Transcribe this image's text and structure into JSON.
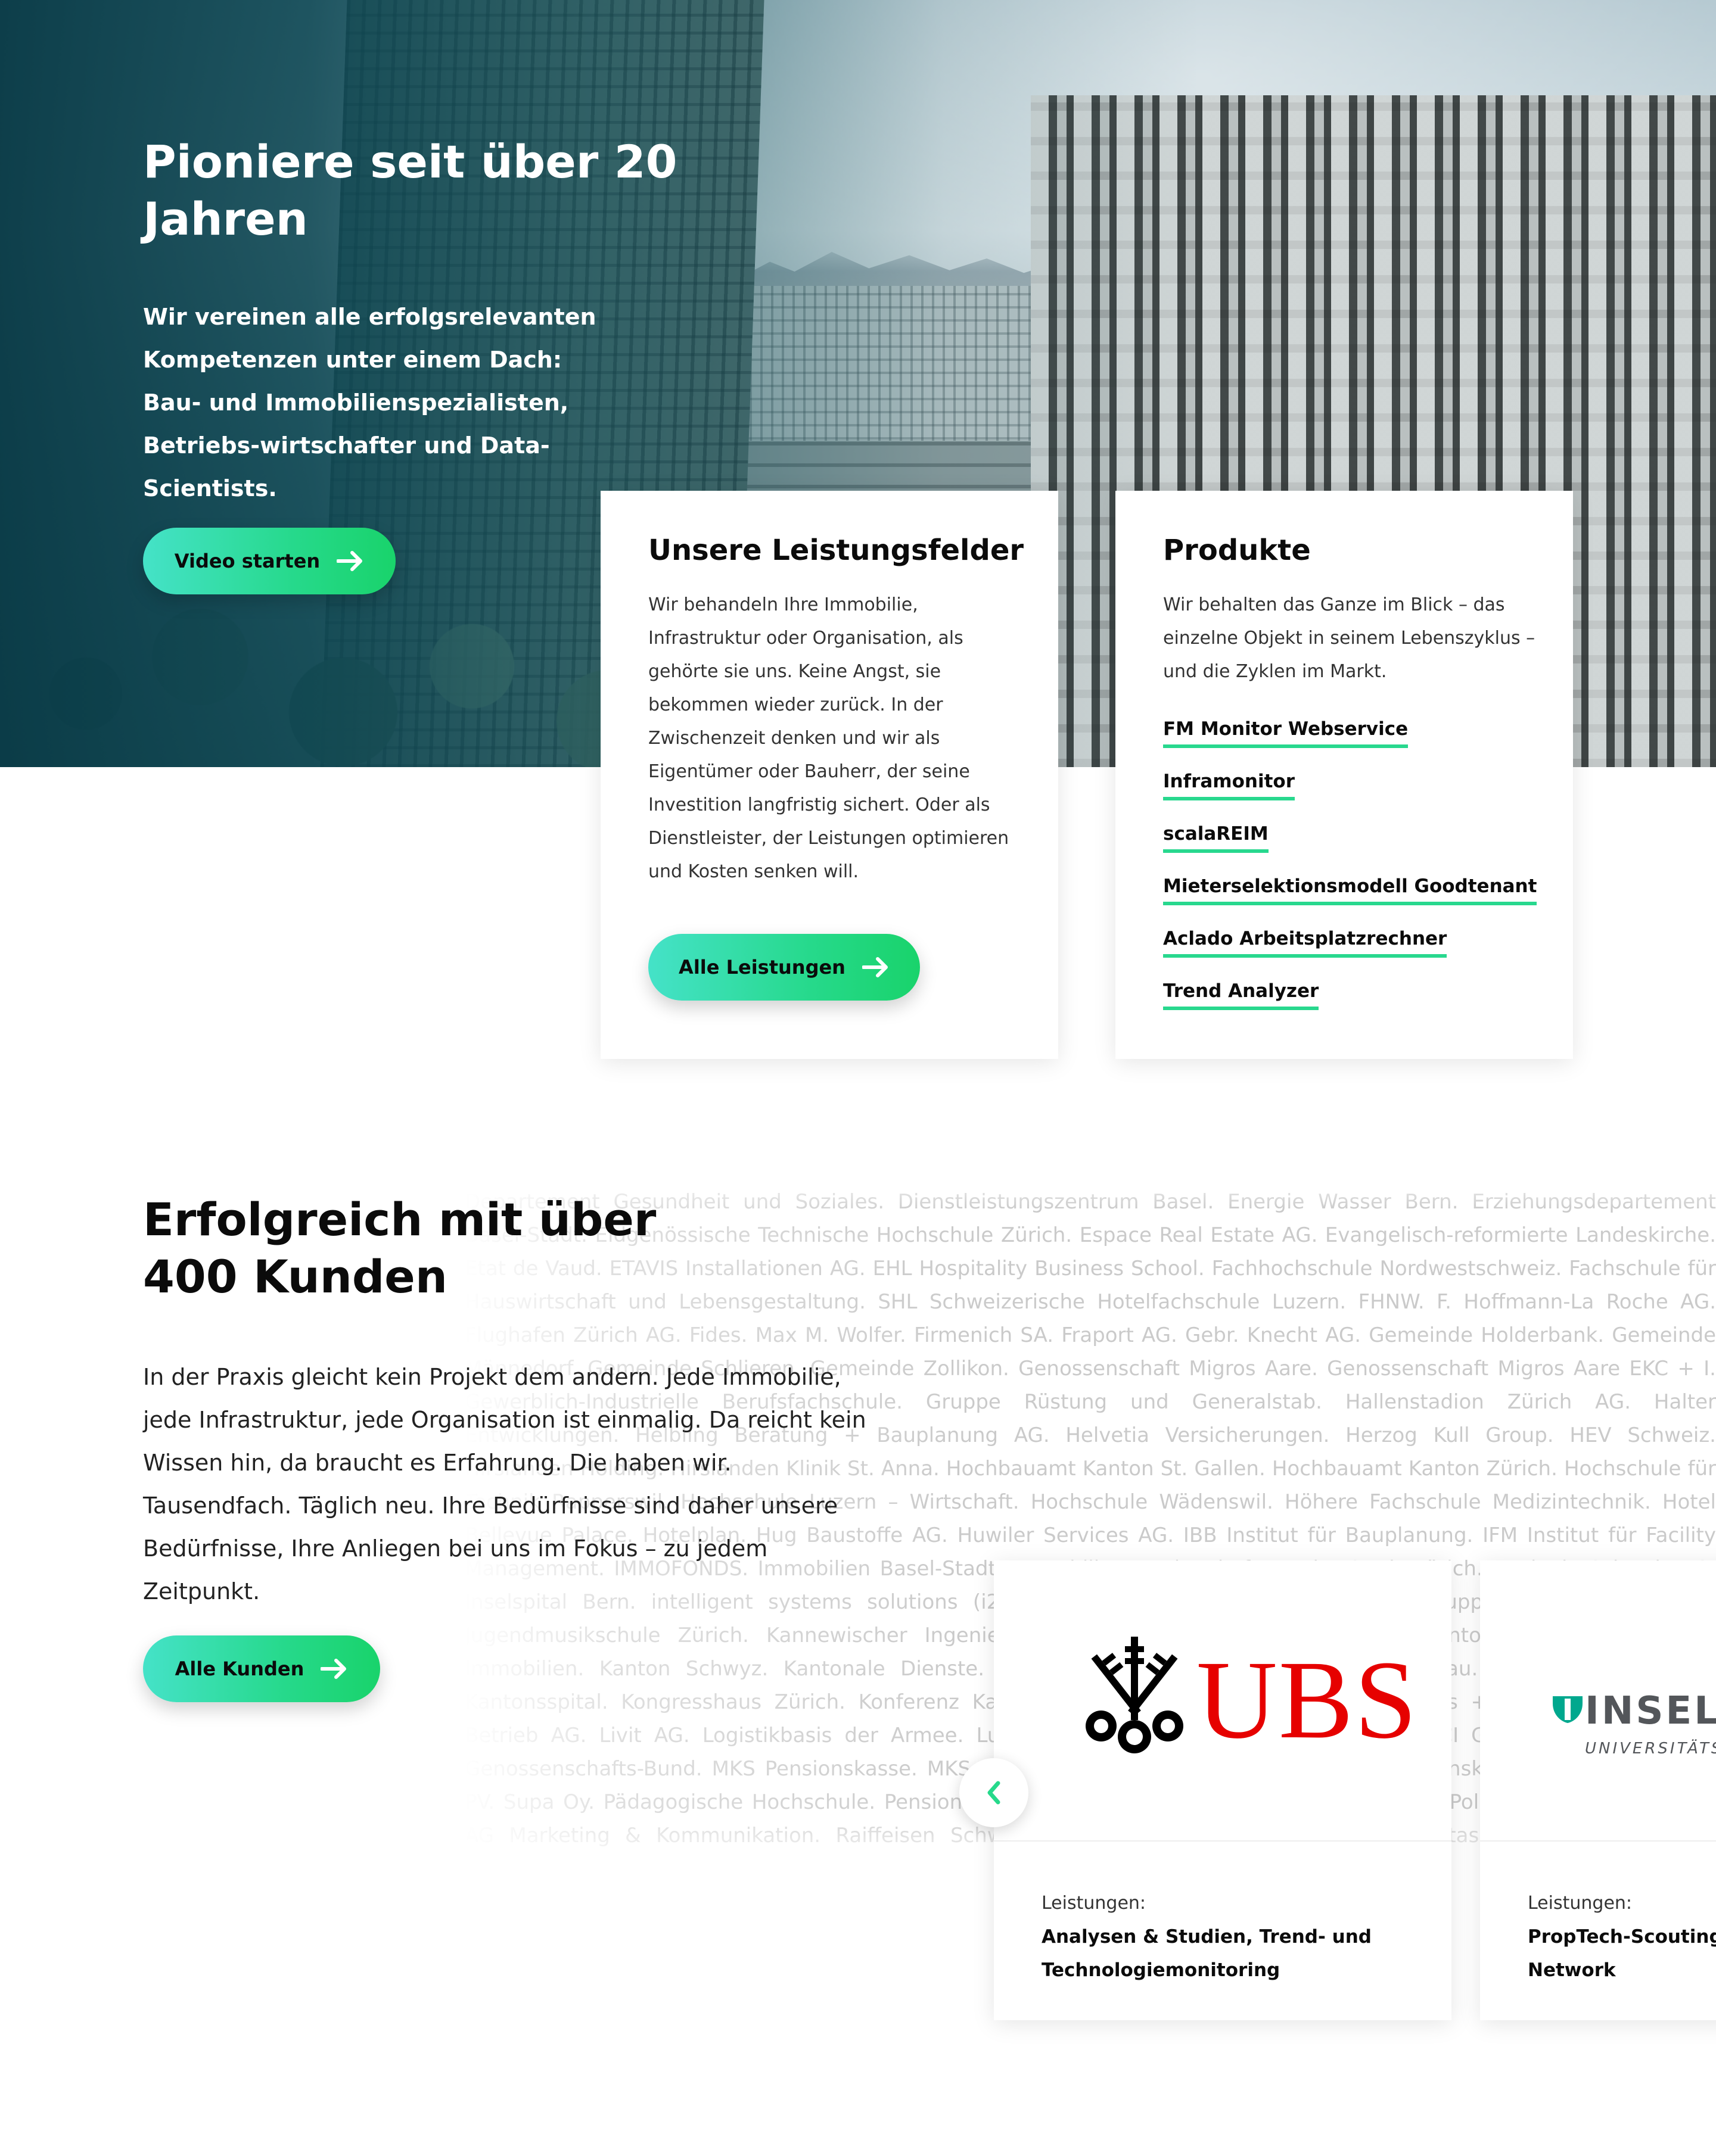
{
  "hero": {
    "title": "Pioniere seit über 20 Jahren",
    "text": "Wir vereinen alle erfolgsrelevanten Kompetenzen unter einem Dach: Bau- und Immobilienspezialisten, Betriebs-wirtschafter und Data-Scientists.",
    "video_button": "Video starten"
  },
  "services_card": {
    "title": "Unsere Leistungsfelder",
    "text": "Wir behandeln Ihre Immobilie, Infrastruktur oder Organisation, als gehörte sie uns. Keine Angst, sie bekommen wieder zurück. In der Zwischenzeit denken und   wir als Eigentümer oder Bauherr, der seine Investition langfristig sichert. Oder als Dienstleister, der Leistungen optimieren und Kosten senken will.",
    "button": "Alle Leistungen"
  },
  "products_card": {
    "title": "Produkte",
    "text": "Wir behalten das Ganze im Blick – das einzelne Objekt in seinem Lebenszyklus – und die Zyklen im Markt.",
    "links": [
      "FM Monitor Webservice",
      "Inframonitor",
      "scalaREIM",
      "Mieterselektionsmodell Goodtenant",
      "Aclado Arbeitsplatzrechner",
      "Trend Analyzer"
    ]
  },
  "customers": {
    "title": "Erfolgreich mit über 400 Kunden",
    "text": "In der Praxis gleicht kein Projekt dem andern. Jede Immobilie, jede Infrastruktur, jede Organisation ist einmalig. Da reicht kein Wissen hin, da braucht es Erfahrung. Die haben wir. Tausendfach. Täglich neu. Ihre Bedürfnisse sind daher unsere Bedürfnisse, Ihre Anliegen bei uns im Fokus – zu jedem Zeitpunkt.",
    "button": "Alle Kunden",
    "background_names": "Departement Gesundheit und Soziales. Dienstleistungszentrum Basel. Energie Wasser Bern. Erziehungsdepartement Basel-Stadt. Eidgenössische Technische Hochschule Zürich. Espace Real Estate AG. Evangelisch-reformierte Landeskirche. Etat de Vaud. ETAVIS Installationen AG. EHL Hospitality Business School. Fachhochschule Nordwestschweiz. Fachschule für Hauswirtschaft und Lebensgestaltung. SHL Schweizerische Hotelfachschule Luzern. FHNW. F. Hoffmann-La Roche AG. Flughafen Zürich AG. Fides. Max M. Wolfer. Firmenich SA. Fraport AG. Gebr. Knecht AG. Gemeinde Holderbank. Gemeinde Männedorf. Gemeinde Schlieren. Gemeinde Zollikon. Genossenschaft Migros Aare. Genossenschaft Migros Aare EKC + I. Gewerblich-Industrielle Berufsfachschule. Gruppe Rüstung und Generalstab. Hallenstadion Zürich AG. Halter Entwicklungen. Helbling Beratung + Bauplanung AG. Helvetia Versicherungen. Herzog Kull Group. HEV Schweiz. Hirslanden Holding. Hirslanden Klinik St. Anna. Hochbauamt Kanton St. Gallen. Hochbauamt Kanton Zürich. Hochschule für Technik Rapperswil. Hochschule Luzern – Wirtschaft. Hochschule Wädenswil. Höhere Fachschule Medizintechnik. Hotel Bellevue Palace. Hotelplan. Hug Baustoffe AG. Huwiler Services AG. IBB Institut für Bauplanung. IFM Institut für Facility Management. IMMOFONDS. Immobilien Basel-Stadt. Immobilien-Bewirtschaftung der Stadt Zürich. Implenia Schweiz AG. Inselspital Bern. intelligent systems solutions (i2s) GmbH. ISS Schweiz AG. its1world Gruppe. IWC Schaffhausen. Jugendmusikschule Zürich. Kannewischer Ingenieurbüro AG. Kanton Basel-Landschaft. Kanton Luzern Dienststelle Immobilien. Kanton Schwyz. Kantonale Dienste. Kantonspolizei Schwyz. Kantonsspital Aarau. Kantonsspital Baden. Kantonsspital. Kongresshaus Zürich. Konferenz Kantonaler Hochbauämter Ostschweiz. Landis + Gyr. Liegenschaften-Betrieb AG. Livit AG. Logistikbasis der Armee. Luzerner Kantonalbank. Maus Frères SA. MCI Group Holding. Migros-Genossenschafts-Bund. MKS Pensionskasse. MKS Marketing- und Kaderschule. Mobimo. Pensionskasse der Stadt Zürich. PV. Supa Oy. Pädagogische Hochschule. Pensionskasse Post. Politische Gemeinde Münchwilen. Polizeidepartement. Quint AG Marketing & Kommunikation. Raiffeisen Schweiz. RTS – Radio Télévision Suisse. Sanitas Krankenversicherung. Schweizerische Bundesbahnen SBB. Schweizerische Post. Siemens Schweiz AG. Stadt Bern. Stadt Luzern. Stadt Winterthur. Stadt Zürich. Swiss Life AG. Swisscom AG. UBS AG. Universität Bern. Universität Zürich. Universitätsspital Basel. Zürcher Kantonalbank.",
    "clients": [
      {
        "logo_name": "UBS",
        "services_label": "Leistungen:",
        "services": "Analysen & Studien, Trend- und Technologiemonitoring"
      },
      {
        "logo_name": "INSELSPITAL",
        "logo_subtitle": "UNIVERSITÄTSSPITAL HOPITAL UNIVERSITAIRE BERN UNIVERSITY",
        "services_label": "Leistungen:",
        "services": "PropTech-Scouting Innovation Network"
      }
    ]
  },
  "colors": {
    "accent_green": "#26d98b",
    "accent_teal": "#45e2c8",
    "ubs_red": "#e60100",
    "hero_overlay": "#083a46"
  },
  "icons": {
    "button_arrow": "arrow-right-icon",
    "carousel_prev": "chevron-left-icon"
  }
}
